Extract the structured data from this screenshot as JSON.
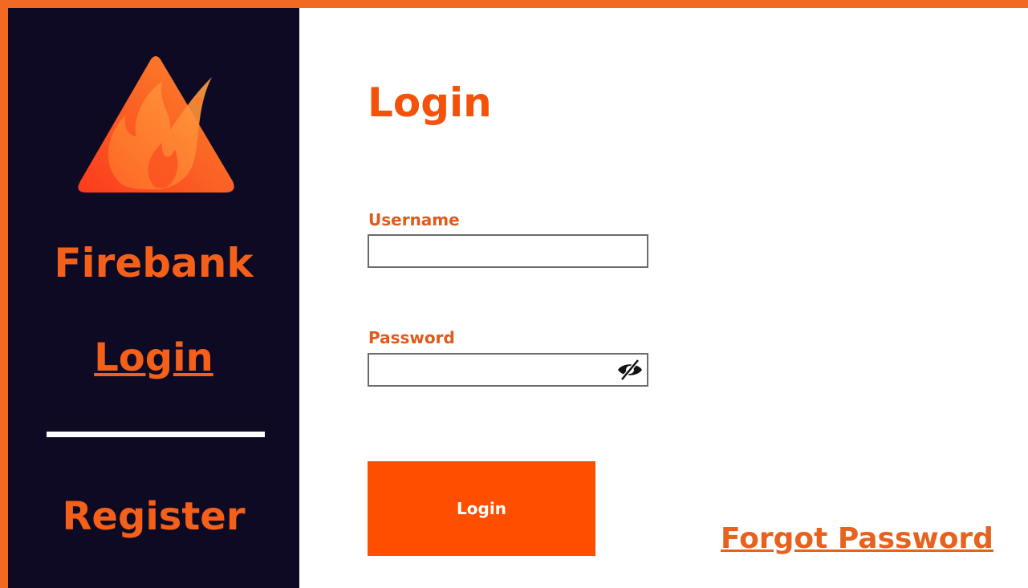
{
  "sidebar": {
    "brand_name": "Firebank",
    "logo_icon": "flame-triangle-logo-icon",
    "nav_login_label": "Login",
    "nav_register_label": "Register"
  },
  "main": {
    "title": "Login",
    "username": {
      "label": "Username",
      "value": "",
      "placeholder": ""
    },
    "password": {
      "label": "Password",
      "value": "",
      "placeholder": "",
      "toggle_icon": "eye-slash-icon"
    },
    "login_button_label": "Login",
    "forgot_password_label": "Forgot Password"
  },
  "colors": {
    "accent": "#f4601a",
    "button": "#fe4f00",
    "sidebar_background": "#0e0a24",
    "border": "#f26a21"
  }
}
